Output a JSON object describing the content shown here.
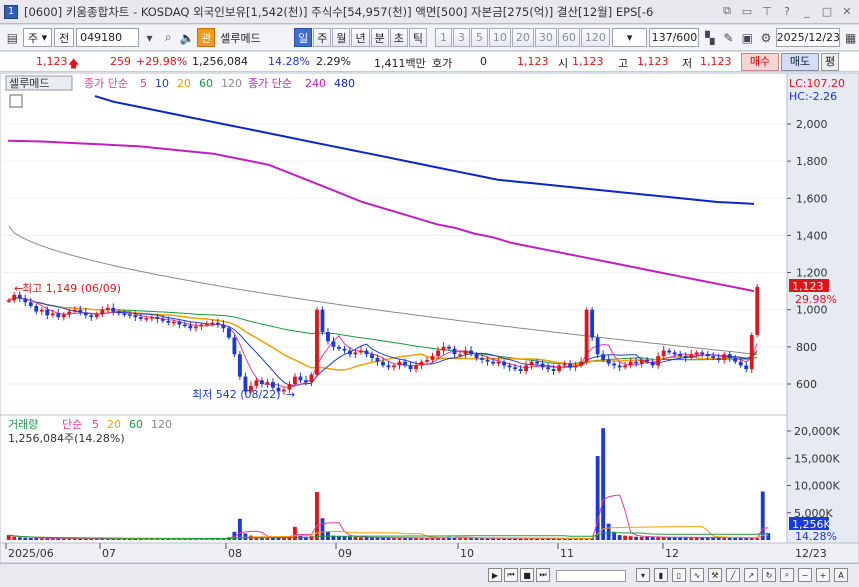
{
  "window": {
    "title": "[0600] 키움종합차트 - KOSDAQ 외국인보유[1,542(천)] 주식수[54,957(천)] 액면[500] 자본금[275(억)] 결산[12월] EPS[-6",
    "app_icon": "1",
    "controls": [
      "window-restore-icon",
      "minimize-icon",
      "pin-icon",
      "help-icon",
      "minimize-bar-icon",
      "maximize-icon",
      "close-icon"
    ]
  },
  "toolbar1": {
    "account_icon": "account-list-icon",
    "period_type": "주",
    "market_select": "전",
    "stock_code": "049180",
    "search_icon": "magnifier-icon",
    "sound_icon": "speaker-icon",
    "badge": "관",
    "stock_name": "셀루메드",
    "period_tabs": [
      "일",
      "주",
      "월",
      "년",
      "분",
      "초",
      "틱"
    ],
    "active_period": "일",
    "intervals": [
      "1",
      "3",
      "5",
      "10",
      "20",
      "30",
      "60",
      "120"
    ],
    "count_display": "137/600",
    "date": "2025/12/23",
    "tool_icons": [
      "chart-tools-icon",
      "draw-icon",
      "save-icon",
      "settings-icon",
      "calendar-icon"
    ]
  },
  "quote": {
    "price": "1,123",
    "change": "259",
    "change_pct": "+29.98%",
    "volume": "1,256,084",
    "vol_ratio": "14.28%",
    "turnover": "2.29%",
    "amount": "1,411백만",
    "hoga_label": "호가",
    "hoga_value": "0",
    "ask_price": "1,123",
    "open_label": "시",
    "open": "1,123",
    "high_label": "고",
    "high": "1,123",
    "low_label": "저",
    "low": "1,123",
    "buy_label": "매수",
    "sell_label": "매도",
    "eval_label": "평"
  },
  "price_panel": {
    "legend_stock": "셀루메드",
    "legend_ma_label": "종가 단순",
    "legend_ma_periods": [
      "5",
      "10",
      "20",
      "60",
      "120"
    ],
    "legend_ma2_label": "종가 단순",
    "legend_ma2_periods": [
      "240",
      "480"
    ],
    "lc_label": "LC:107.20",
    "hc_label": "HC:-2.26",
    "y_ticks": [
      "2,000",
      "1,800",
      "1,600",
      "1,400",
      "1,200",
      "1,000",
      "800",
      "600"
    ],
    "current_price_tag": "1,123",
    "current_pct_tag": "29.98%",
    "high_annotation": "최고 1,149 (06/09)",
    "low_annotation": "최저 542 (08/22)"
  },
  "volume_panel": {
    "legend_label": "거래량",
    "legend_ma_label": "단순",
    "legend_ma_periods": [
      "5",
      "20",
      "60",
      "120"
    ],
    "value_label": "1,256,084주(14.28%)",
    "y_ticks": [
      "20,000K",
      "15,000K",
      "10,000K",
      "5,000K"
    ],
    "current_tag": "1,256K",
    "current_pct_tag": "14.28%"
  },
  "x_axis": {
    "labels": [
      "2025/06",
      "07",
      "08",
      "09",
      "10",
      "11",
      "12"
    ],
    "end_label": "12/23"
  },
  "colors": {
    "up": "#e0151b",
    "down": "#1b39d6",
    "ma5": "#e23b9e",
    "ma10": "#1f3fcf",
    "ma20": "#f2a000",
    "ma60": "#1a9b3c",
    "ma120": "#8a8a8a",
    "ma240": "#c21fbf",
    "ma480": "#0c26c9"
  },
  "chart_data": {
    "type": "candlestick",
    "title": "셀루메드",
    "period": "daily",
    "x_start": "2025/06",
    "x_end": "2025/12/23",
    "ylim": [
      500,
      2100
    ],
    "highest": {
      "price": 1149,
      "date": "06/09"
    },
    "lowest": {
      "price": 542,
      "date": "08/22"
    },
    "last": {
      "date": "2025/12/23",
      "close": 1123,
      "change": 259,
      "change_pct": 29.98,
      "volume": 1256084
    },
    "closes": [
      1050,
      1080,
      1060,
      1040,
      1020,
      990,
      1000,
      970,
      980,
      960,
      975,
      990,
      1000,
      985,
      970,
      960,
      975,
      1000,
      1010,
      990,
      980,
      975,
      970,
      960,
      950,
      955,
      960,
      950,
      940,
      930,
      935,
      920,
      915,
      900,
      910,
      920,
      925,
      930,
      920,
      900,
      850,
      760,
      640,
      560,
      590,
      620,
      600,
      610,
      580,
      560,
      570,
      600,
      640,
      620,
      610,
      650,
      1000,
      880,
      830,
      800,
      790,
      780,
      760,
      770,
      780,
      760,
      740,
      720,
      700,
      690,
      700,
      720,
      700,
      680,
      700,
      720,
      730,
      750,
      780,
      800,
      790,
      760,
      760,
      780,
      760,
      740,
      730,
      720,
      710,
      720,
      700,
      690,
      680,
      670,
      700,
      720,
      710,
      690,
      680,
      670,
      700,
      710,
      690,
      700,
      720,
      1000,
      850,
      760,
      730,
      710,
      700,
      690,
      700,
      720,
      710,
      730,
      720,
      700,
      750,
      780,
      770,
      760,
      750,
      740,
      760,
      770,
      760,
      750,
      740,
      730,
      760,
      740,
      720,
      700,
      680,
      864,
      1123
    ],
    "volumes_k": [
      900,
      600,
      500,
      400,
      380,
      350,
      300,
      320,
      310,
      290,
      300,
      280,
      270,
      260,
      280,
      260,
      250,
      240,
      230,
      220,
      210,
      200,
      210,
      220,
      200,
      190,
      180,
      200,
      210,
      220,
      200,
      190,
      180,
      170,
      180,
      200,
      220,
      240,
      260,
      300,
      500,
      1500,
      3900,
      1200,
      800,
      600,
      500,
      400,
      450,
      500,
      600,
      700,
      2400,
      800,
      600,
      700,
      8800,
      4000,
      1500,
      800,
      700,
      650,
      600,
      550,
      500,
      480,
      460,
      440,
      420,
      400,
      380,
      400,
      420,
      380,
      360,
      340,
      360,
      380,
      400,
      500,
      600,
      550,
      450,
      400,
      380,
      360,
      340,
      320,
      300,
      310,
      320,
      300,
      290,
      280,
      300,
      320,
      310,
      300,
      290,
      280,
      300,
      310,
      300,
      290,
      280,
      300,
      320,
      15400,
      20500,
      3000,
      1500,
      900,
      800,
      700,
      600,
      580,
      560,
      540,
      520,
      500,
      480,
      460,
      500,
      520,
      480,
      460,
      440,
      420,
      460,
      480,
      460,
      440,
      420,
      400,
      380,
      360,
      340,
      8900,
      1256
    ],
    "ma240": [
      1910,
      1908,
      1905,
      1900,
      1895,
      1890,
      1885,
      1880,
      1870,
      1860,
      1850,
      1840,
      1820,
      1800,
      1780,
      1740,
      1700,
      1660,
      1620,
      1580,
      1550,
      1520,
      1490,
      1460,
      1440,
      1410,
      1390,
      1360,
      1340,
      1320,
      1300,
      1280,
      1260,
      1240,
      1220,
      1200,
      1180,
      1160,
      1140,
      1120,
      1100
    ],
    "ma480": [
      2150,
      2120,
      2100,
      2080,
      2060,
      2040,
      2020,
      2000,
      1980,
      1960,
      1940,
      1920,
      1900,
      1880,
      1860,
      1840,
      1820,
      1800,
      1780,
      1760,
      1740,
      1720,
      1700,
      1690,
      1680,
      1670,
      1660,
      1650,
      1640,
      1630,
      1620,
      1610,
      1600,
      1590,
      1580,
      1575,
      1570
    ]
  }
}
